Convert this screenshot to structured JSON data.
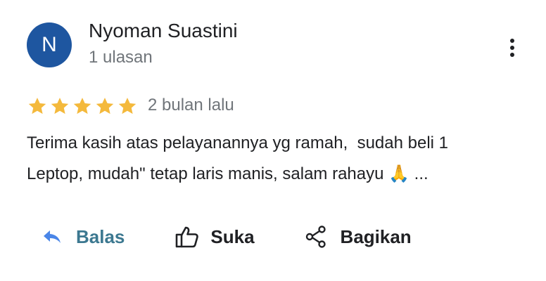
{
  "review": {
    "author": {
      "initial": "N",
      "name": "Nyoman Suastini",
      "review_count": "1 ulasan",
      "avatar_color": "#1e56a0"
    },
    "rating": 5,
    "rating_max": 5,
    "date": "2 bulan lalu",
    "text_lines": [
      "Terima kasih atas pelayanannya yg ramah,  sudah beli 1",
      "Leptop, mudah\" tetap laris manis, salam rahayu 🙏 ..."
    ],
    "star_color": "#f4b93c"
  },
  "actions": {
    "reply_label": "Balas",
    "like_label": "Suka",
    "share_label": "Bagikan",
    "reply_color": "#3c7890",
    "reply_icon_color": "#4a86e8"
  },
  "icons": {
    "more": "more-vert-icon",
    "reply": "reply-icon",
    "like": "thumb-up-icon",
    "share": "share-icon",
    "star": "star-icon"
  }
}
